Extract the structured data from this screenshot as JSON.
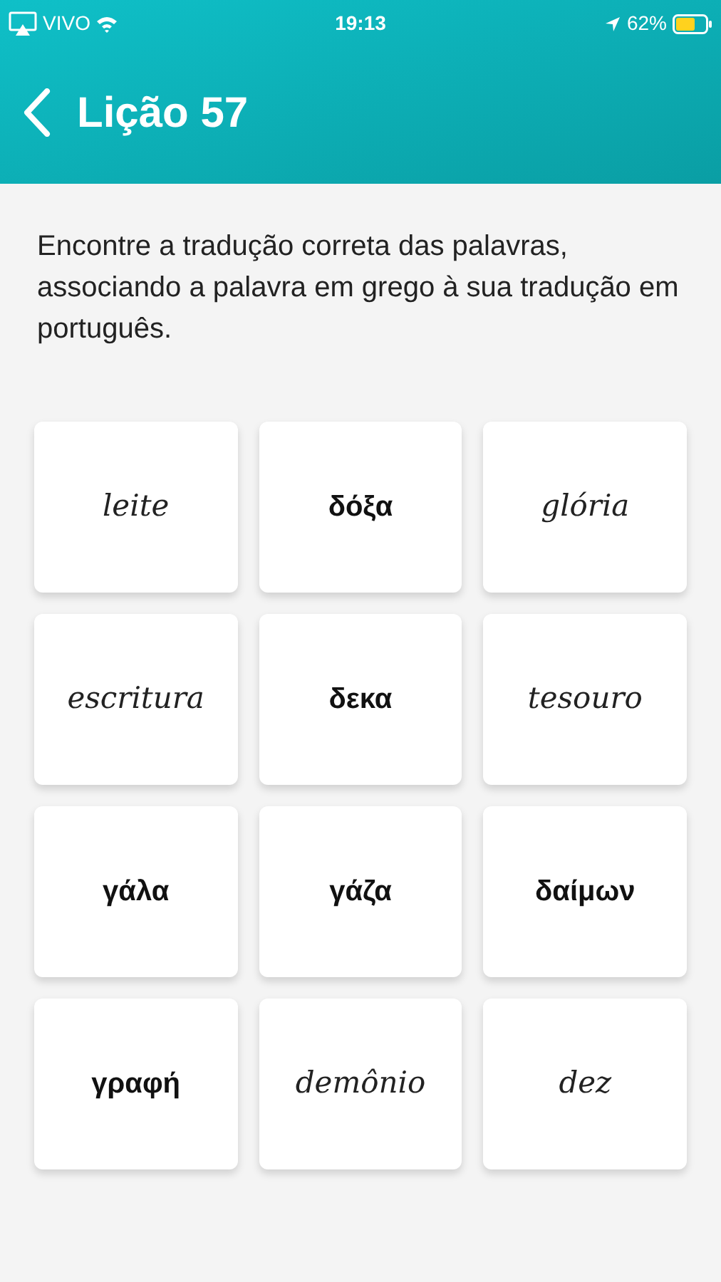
{
  "status_bar": {
    "carrier": "VIVO",
    "time": "19:13",
    "battery": "62%"
  },
  "header": {
    "title": "Lição 57"
  },
  "instructions": "Encontre a tradução correta das palavras, associando a palavra em grego à sua tradução em português.",
  "cards": [
    {
      "text": "leite",
      "kind": "portuguese"
    },
    {
      "text": "δόξα",
      "kind": "greek"
    },
    {
      "text": "glória",
      "kind": "portuguese"
    },
    {
      "text": "escritura",
      "kind": "portuguese"
    },
    {
      "text": "δεκα",
      "kind": "greek"
    },
    {
      "text": "tesouro",
      "kind": "portuguese"
    },
    {
      "text": "γάλα",
      "kind": "greek"
    },
    {
      "text": "γάζα",
      "kind": "greek"
    },
    {
      "text": "δαίμων",
      "kind": "greek"
    },
    {
      "text": "γραφή",
      "kind": "greek"
    },
    {
      "text": "demônio",
      "kind": "portuguese"
    },
    {
      "text": "dez",
      "kind": "portuguese"
    }
  ]
}
